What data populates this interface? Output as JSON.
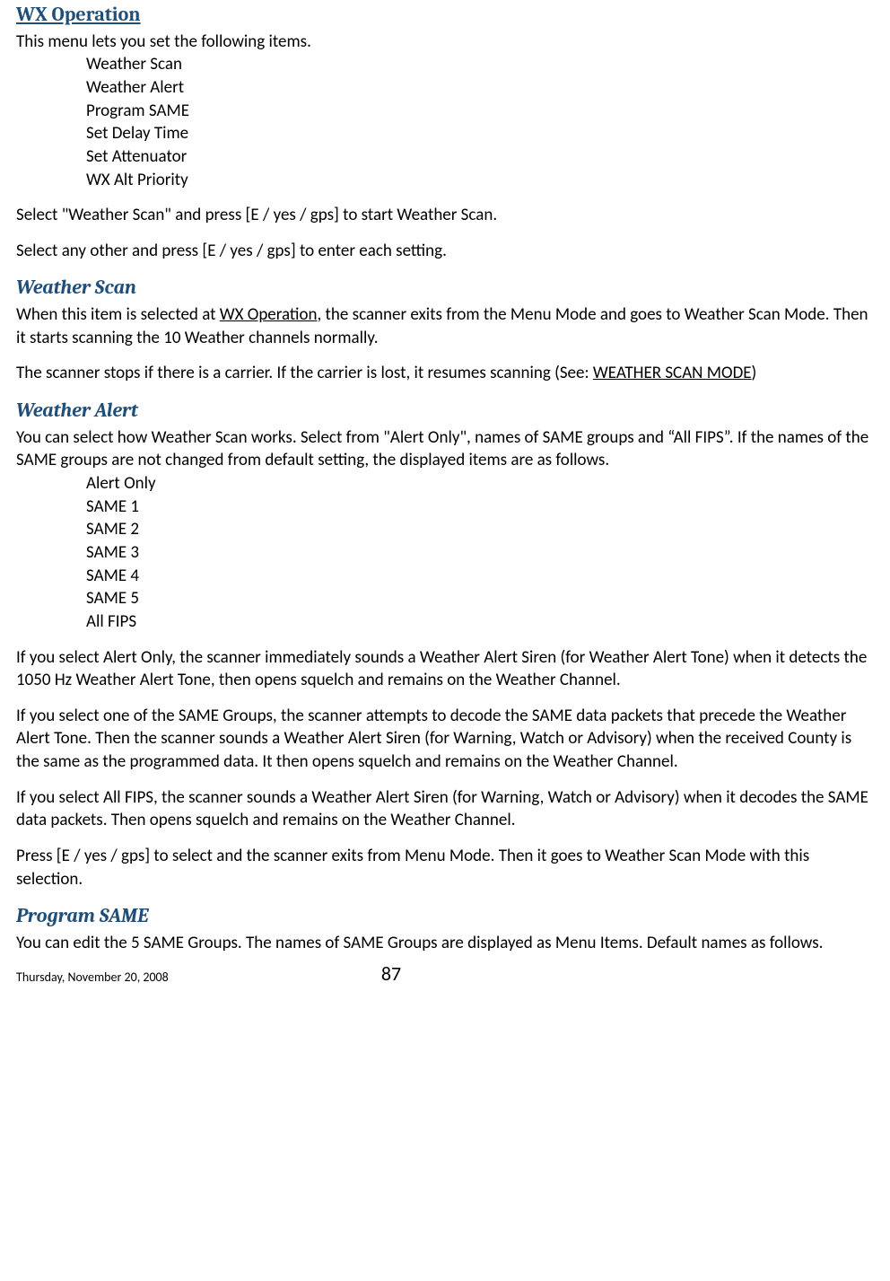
{
  "sections": {
    "wx_operation": {
      "title": "WX Operation",
      "intro": "This menu lets you set the following items.",
      "menu_items": [
        "Weather Scan",
        "Weather Alert",
        "Program SAME",
        "Set Delay Time",
        "Set Attenuator",
        "WX Alt Priority"
      ],
      "para2": "Select \"Weather Scan\" and press [E / yes / gps] to start Weather Scan.",
      "para3": "Select any other and press [E / yes / gps] to enter each setting."
    },
    "weather_scan": {
      "title": "Weather Scan",
      "para1_a": "When this item is selected at ",
      "para1_link": "WX Operation",
      "para1_b": ", the scanner exits from the Menu Mode and goes to Weather Scan Mode. Then it starts scanning the 10 Weather channels normally.",
      "para2_a": "The scanner stops if there is a carrier. If the carrier is lost, it resumes scanning (See: ",
      "para2_link": "WEATHER SCAN MODE",
      "para2_b": ")"
    },
    "weather_alert": {
      "title": "Weather Alert",
      "para1": "You can select how Weather Scan works. Select from \"Alert Only\", names of SAME groups and “All FIPS”. If the names of the SAME groups are not changed from default setting, the displayed items are as follows.",
      "menu_items": [
        "Alert Only",
        "SAME 1",
        "SAME 2",
        "SAME 3",
        "SAME 4",
        "SAME 5",
        "All FIPS"
      ],
      "para2": "If you select Alert Only, the scanner immediately sounds a Weather Alert Siren (for Weather Alert Tone) when it detects the 1050 Hz Weather Alert Tone, then opens squelch and remains on the Weather Channel.",
      "para3": "If you select one of the SAME Groups, the scanner attempts to decode the SAME data packets that precede the Weather Alert Tone. Then the scanner sounds a Weather Alert Siren (for Warning, Watch or Advisory) when the received County is the same as the programmed data. It then opens squelch and remains on the Weather Channel.",
      "para4": "If you select All FIPS, the scanner sounds a Weather Alert Siren (for Warning, Watch or Advisory) when it decodes the SAME data packets. Then opens squelch and remains on the Weather Channel.",
      "para5": "Press [E / yes / gps] to select and the scanner exits from Menu Mode. Then it goes to Weather Scan Mode with this selection."
    },
    "program_same": {
      "title": "Program SAME",
      "para1": "You can edit the 5 SAME Groups. The names of SAME Groups are displayed as Menu Items. Default names as follows."
    }
  },
  "footer": {
    "date": "Thursday, November 20, 2008",
    "page": "87"
  }
}
